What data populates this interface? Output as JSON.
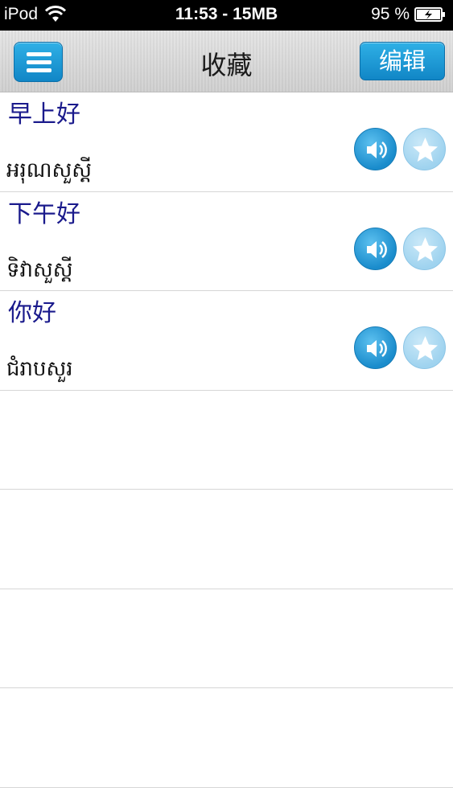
{
  "status_bar": {
    "carrier": "iPod",
    "center": "11:53 - 15MB",
    "battery": "95 %",
    "icons": [
      "wifi-icon",
      "battery-charging-icon"
    ]
  },
  "nav": {
    "title": "收藏",
    "edit_label": "编辑",
    "menu_icon": "hamburger-menu-icon"
  },
  "favorites": [
    {
      "chinese": "早上好",
      "khmer": "អរុណសួស្តី"
    },
    {
      "chinese": "下午好",
      "khmer": "ទិវាសួស្តី"
    },
    {
      "chinese": "你好",
      "khmer": "ជំរាបសួរ"
    }
  ],
  "row_icons": [
    "speaker-icon",
    "star-icon"
  ],
  "colors": {
    "accent": "#1a8ccc",
    "chinese_text": "#1a1a8c"
  }
}
